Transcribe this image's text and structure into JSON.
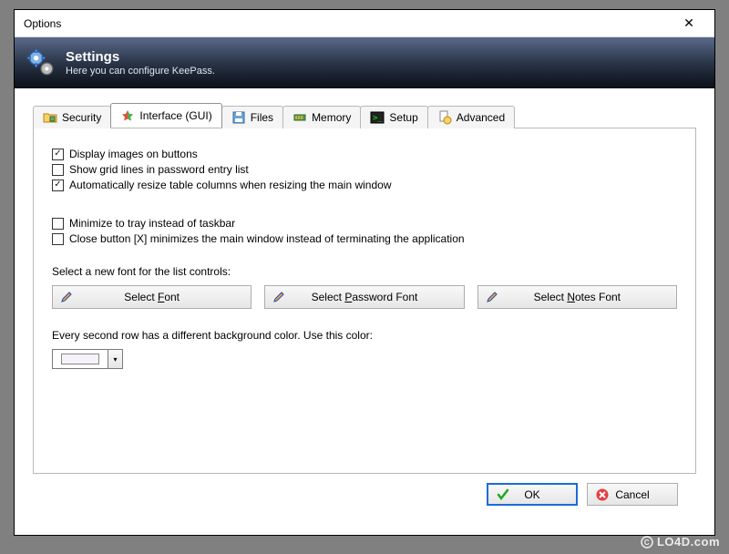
{
  "window": {
    "title": "Options",
    "close": "✕"
  },
  "banner": {
    "title": "Settings",
    "subtitle": "Here you can configure KeePass."
  },
  "tabs": [
    {
      "label": "Security"
    },
    {
      "label": "Interface (GUI)"
    },
    {
      "label": "Files"
    },
    {
      "label": "Memory"
    },
    {
      "label": "Setup"
    },
    {
      "label": "Advanced"
    }
  ],
  "checks": {
    "display_images": {
      "label": "Display images on buttons",
      "checked": true
    },
    "grid_lines": {
      "label": "Show grid lines in password entry list",
      "checked": false
    },
    "auto_resize": {
      "label": "Automatically resize table columns when resizing the main window",
      "checked": true
    },
    "min_tray": {
      "label": "Minimize to tray instead of taskbar",
      "checked": false
    },
    "close_minimize": {
      "label": "Close button [X] minimizes the main window instead of terminating the application",
      "checked": false
    }
  },
  "font_section": {
    "label": "Select a new font for the list controls:",
    "btn_font": "Select Font",
    "btn_pw_font": "Select Password Font",
    "btn_notes_font": "Select Notes Font"
  },
  "color_section": {
    "label": "Every second row has a different background color. Use this color:",
    "swatch_color": "#f6f2fb"
  },
  "footer": {
    "ok": "OK",
    "cancel": "Cancel"
  },
  "watermark": "LO4D.com"
}
